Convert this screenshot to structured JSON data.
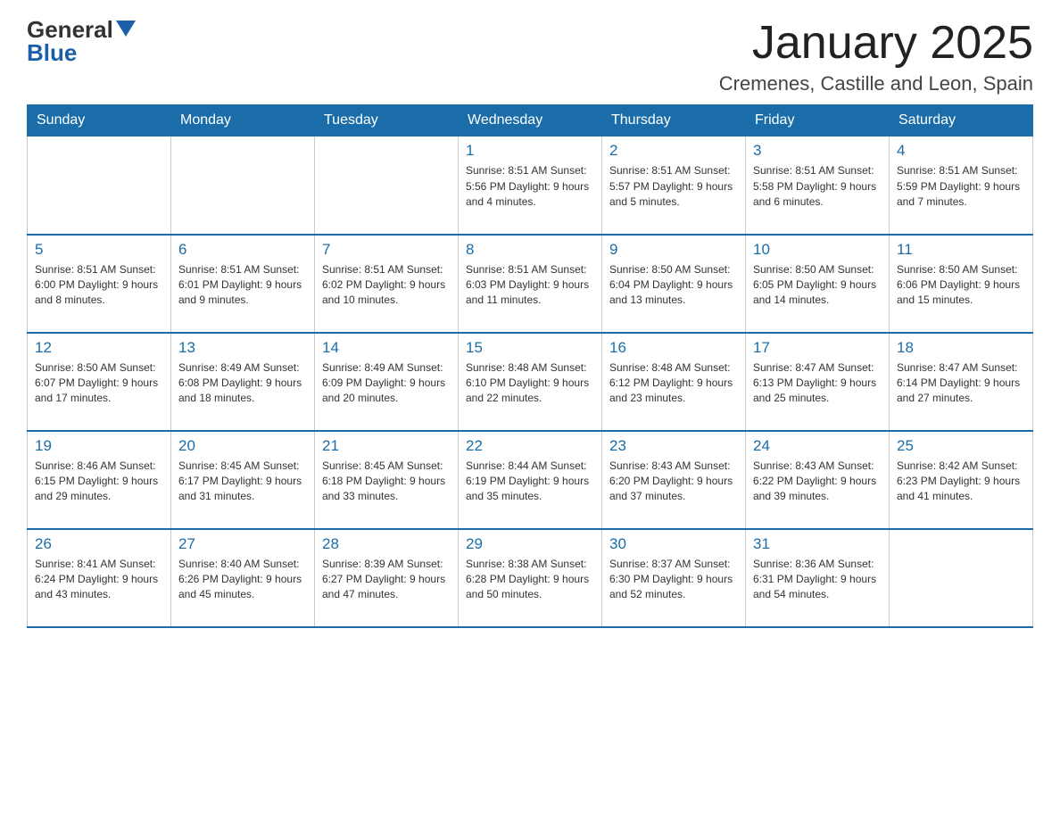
{
  "header": {
    "logo_general": "General",
    "logo_blue": "Blue",
    "title": "January 2025",
    "subtitle": "Cremenes, Castille and Leon, Spain"
  },
  "weekdays": [
    "Sunday",
    "Monday",
    "Tuesday",
    "Wednesday",
    "Thursday",
    "Friday",
    "Saturday"
  ],
  "weeks": [
    [
      {
        "day": "",
        "info": ""
      },
      {
        "day": "",
        "info": ""
      },
      {
        "day": "",
        "info": ""
      },
      {
        "day": "1",
        "info": "Sunrise: 8:51 AM\nSunset: 5:56 PM\nDaylight: 9 hours and 4 minutes."
      },
      {
        "day": "2",
        "info": "Sunrise: 8:51 AM\nSunset: 5:57 PM\nDaylight: 9 hours and 5 minutes."
      },
      {
        "day": "3",
        "info": "Sunrise: 8:51 AM\nSunset: 5:58 PM\nDaylight: 9 hours and 6 minutes."
      },
      {
        "day": "4",
        "info": "Sunrise: 8:51 AM\nSunset: 5:59 PM\nDaylight: 9 hours and 7 minutes."
      }
    ],
    [
      {
        "day": "5",
        "info": "Sunrise: 8:51 AM\nSunset: 6:00 PM\nDaylight: 9 hours and 8 minutes."
      },
      {
        "day": "6",
        "info": "Sunrise: 8:51 AM\nSunset: 6:01 PM\nDaylight: 9 hours and 9 minutes."
      },
      {
        "day": "7",
        "info": "Sunrise: 8:51 AM\nSunset: 6:02 PM\nDaylight: 9 hours and 10 minutes."
      },
      {
        "day": "8",
        "info": "Sunrise: 8:51 AM\nSunset: 6:03 PM\nDaylight: 9 hours and 11 minutes."
      },
      {
        "day": "9",
        "info": "Sunrise: 8:50 AM\nSunset: 6:04 PM\nDaylight: 9 hours and 13 minutes."
      },
      {
        "day": "10",
        "info": "Sunrise: 8:50 AM\nSunset: 6:05 PM\nDaylight: 9 hours and 14 minutes."
      },
      {
        "day": "11",
        "info": "Sunrise: 8:50 AM\nSunset: 6:06 PM\nDaylight: 9 hours and 15 minutes."
      }
    ],
    [
      {
        "day": "12",
        "info": "Sunrise: 8:50 AM\nSunset: 6:07 PM\nDaylight: 9 hours and 17 minutes."
      },
      {
        "day": "13",
        "info": "Sunrise: 8:49 AM\nSunset: 6:08 PM\nDaylight: 9 hours and 18 minutes."
      },
      {
        "day": "14",
        "info": "Sunrise: 8:49 AM\nSunset: 6:09 PM\nDaylight: 9 hours and 20 minutes."
      },
      {
        "day": "15",
        "info": "Sunrise: 8:48 AM\nSunset: 6:10 PM\nDaylight: 9 hours and 22 minutes."
      },
      {
        "day": "16",
        "info": "Sunrise: 8:48 AM\nSunset: 6:12 PM\nDaylight: 9 hours and 23 minutes."
      },
      {
        "day": "17",
        "info": "Sunrise: 8:47 AM\nSunset: 6:13 PM\nDaylight: 9 hours and 25 minutes."
      },
      {
        "day": "18",
        "info": "Sunrise: 8:47 AM\nSunset: 6:14 PM\nDaylight: 9 hours and 27 minutes."
      }
    ],
    [
      {
        "day": "19",
        "info": "Sunrise: 8:46 AM\nSunset: 6:15 PM\nDaylight: 9 hours and 29 minutes."
      },
      {
        "day": "20",
        "info": "Sunrise: 8:45 AM\nSunset: 6:17 PM\nDaylight: 9 hours and 31 minutes."
      },
      {
        "day": "21",
        "info": "Sunrise: 8:45 AM\nSunset: 6:18 PM\nDaylight: 9 hours and 33 minutes."
      },
      {
        "day": "22",
        "info": "Sunrise: 8:44 AM\nSunset: 6:19 PM\nDaylight: 9 hours and 35 minutes."
      },
      {
        "day": "23",
        "info": "Sunrise: 8:43 AM\nSunset: 6:20 PM\nDaylight: 9 hours and 37 minutes."
      },
      {
        "day": "24",
        "info": "Sunrise: 8:43 AM\nSunset: 6:22 PM\nDaylight: 9 hours and 39 minutes."
      },
      {
        "day": "25",
        "info": "Sunrise: 8:42 AM\nSunset: 6:23 PM\nDaylight: 9 hours and 41 minutes."
      }
    ],
    [
      {
        "day": "26",
        "info": "Sunrise: 8:41 AM\nSunset: 6:24 PM\nDaylight: 9 hours and 43 minutes."
      },
      {
        "day": "27",
        "info": "Sunrise: 8:40 AM\nSunset: 6:26 PM\nDaylight: 9 hours and 45 minutes."
      },
      {
        "day": "28",
        "info": "Sunrise: 8:39 AM\nSunset: 6:27 PM\nDaylight: 9 hours and 47 minutes."
      },
      {
        "day": "29",
        "info": "Sunrise: 8:38 AM\nSunset: 6:28 PM\nDaylight: 9 hours and 50 minutes."
      },
      {
        "day": "30",
        "info": "Sunrise: 8:37 AM\nSunset: 6:30 PM\nDaylight: 9 hours and 52 minutes."
      },
      {
        "day": "31",
        "info": "Sunrise: 8:36 AM\nSunset: 6:31 PM\nDaylight: 9 hours and 54 minutes."
      },
      {
        "day": "",
        "info": ""
      }
    ]
  ]
}
